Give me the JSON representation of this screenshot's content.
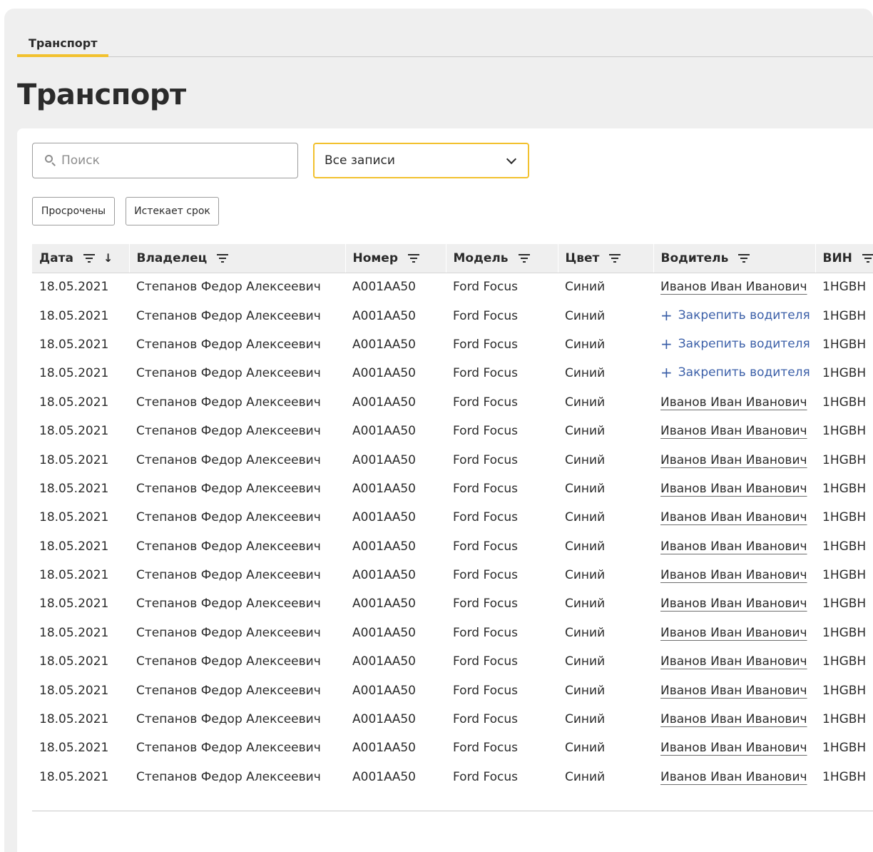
{
  "tabs": [
    {
      "label": "Транспорт",
      "active": true
    }
  ],
  "page_title": "Транспорт",
  "search": {
    "placeholder": "Поиск",
    "value": ""
  },
  "records_select": {
    "value": "Все записи"
  },
  "filter_chips": [
    {
      "label": "Просрочены"
    },
    {
      "label": "Истекает срок"
    }
  ],
  "table": {
    "columns": [
      {
        "label": "Дата",
        "filter": true,
        "sort": "desc"
      },
      {
        "label": "Владелец",
        "filter": true
      },
      {
        "label": "Номер",
        "filter": true
      },
      {
        "label": "Модель",
        "filter": true
      },
      {
        "label": "Цвет",
        "filter": true
      },
      {
        "label": "Водитель",
        "filter": true
      },
      {
        "label": "ВИН",
        "filter": true
      }
    ],
    "assign_label": "Закрепить водителя",
    "rows": [
      {
        "date": "18.05.2021",
        "owner": "Степанов Федор Алексеевич",
        "number": "А001АА50",
        "model": "Ford Focus",
        "color": "Синий",
        "driver": "Иванов Иван Иванович",
        "vin": "1HGBH"
      },
      {
        "date": "18.05.2021",
        "owner": "Степанов Федор Алексеевич",
        "number": "А001АА50",
        "model": "Ford Focus",
        "color": "Синий",
        "driver": null,
        "vin": "1HGBH"
      },
      {
        "date": "18.05.2021",
        "owner": "Степанов Федор Алексеевич",
        "number": "А001АА50",
        "model": "Ford Focus",
        "color": "Синий",
        "driver": null,
        "vin": "1HGBH"
      },
      {
        "date": "18.05.2021",
        "owner": "Степанов Федор Алексеевич",
        "number": "А001АА50",
        "model": "Ford Focus",
        "color": "Синий",
        "driver": null,
        "vin": "1HGBH"
      },
      {
        "date": "18.05.2021",
        "owner": "Степанов Федор Алексеевич",
        "number": "А001АА50",
        "model": "Ford Focus",
        "color": "Синий",
        "driver": "Иванов Иван Иванович",
        "vin": "1HGBH"
      },
      {
        "date": "18.05.2021",
        "owner": "Степанов Федор Алексеевич",
        "number": "А001АА50",
        "model": "Ford Focus",
        "color": "Синий",
        "driver": "Иванов Иван Иванович",
        "vin": "1HGBH"
      },
      {
        "date": "18.05.2021",
        "owner": "Степанов Федор Алексеевич",
        "number": "А001АА50",
        "model": "Ford Focus",
        "color": "Синий",
        "driver": "Иванов Иван Иванович",
        "vin": "1HGBH"
      },
      {
        "date": "18.05.2021",
        "owner": "Степанов Федор Алексеевич",
        "number": "А001АА50",
        "model": "Ford Focus",
        "color": "Синий",
        "driver": "Иванов Иван Иванович",
        "vin": "1HGBH"
      },
      {
        "date": "18.05.2021",
        "owner": "Степанов Федор Алексеевич",
        "number": "А001АА50",
        "model": "Ford Focus",
        "color": "Синий",
        "driver": "Иванов Иван Иванович",
        "vin": "1HGBH"
      },
      {
        "date": "18.05.2021",
        "owner": "Степанов Федор Алексеевич",
        "number": "А001АА50",
        "model": "Ford Focus",
        "color": "Синий",
        "driver": "Иванов Иван Иванович",
        "vin": "1HGBH"
      },
      {
        "date": "18.05.2021",
        "owner": "Степанов Федор Алексеевич",
        "number": "А001АА50",
        "model": "Ford Focus",
        "color": "Синий",
        "driver": "Иванов Иван Иванович",
        "vin": "1HGBH"
      },
      {
        "date": "18.05.2021",
        "owner": "Степанов Федор Алексеевич",
        "number": "А001АА50",
        "model": "Ford Focus",
        "color": "Синий",
        "driver": "Иванов Иван Иванович",
        "vin": "1HGBH"
      },
      {
        "date": "18.05.2021",
        "owner": "Степанов Федор Алексеевич",
        "number": "А001АА50",
        "model": "Ford Focus",
        "color": "Синий",
        "driver": "Иванов Иван Иванович",
        "vin": "1HGBH"
      },
      {
        "date": "18.05.2021",
        "owner": "Степанов Федор Алексеевич",
        "number": "А001АА50",
        "model": "Ford Focus",
        "color": "Синий",
        "driver": "Иванов Иван Иванович",
        "vin": "1HGBH"
      },
      {
        "date": "18.05.2021",
        "owner": "Степанов Федор Алексеевич",
        "number": "А001АА50",
        "model": "Ford Focus",
        "color": "Синий",
        "driver": "Иванов Иван Иванович",
        "vin": "1HGBH"
      },
      {
        "date": "18.05.2021",
        "owner": "Степанов Федор Алексеевич",
        "number": "А001АА50",
        "model": "Ford Focus",
        "color": "Синий",
        "driver": "Иванов Иван Иванович",
        "vin": "1HGBH"
      },
      {
        "date": "18.05.2021",
        "owner": "Степанов Федор Алексеевич",
        "number": "А001АА50",
        "model": "Ford Focus",
        "color": "Синий",
        "driver": "Иванов Иван Иванович",
        "vin": "1HGBH"
      },
      {
        "date": "18.05.2021",
        "owner": "Степанов Федор Алексеевич",
        "number": "А001АА50",
        "model": "Ford Focus",
        "color": "Синий",
        "driver": "Иванов Иван Иванович",
        "vin": "1HGBH"
      }
    ]
  },
  "icons": {
    "search": "search-icon",
    "dropdown": "chevron-down-icon",
    "filter": "filter-icon",
    "sort": "arrow-down-icon",
    "add": "plus-icon"
  },
  "colors": {
    "accent": "#f2c12e",
    "link": "#3b5fa8",
    "header_bg": "#efefef",
    "page_bg": "#efefef"
  }
}
